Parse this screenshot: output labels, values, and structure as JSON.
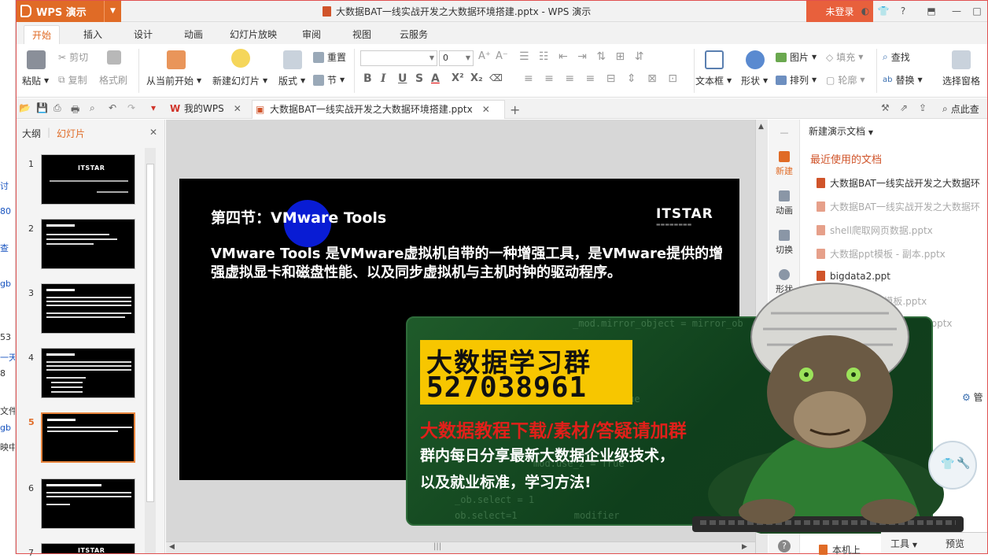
{
  "left_strip": [
    "讨",
    "80",
    "查",
    "gb",
    "53",
    "一天",
    "8",
    "文件",
    "gb",
    "映中"
  ],
  "app": {
    "name": "WPS 演示",
    "doc_title": "大数据BAT一线实战开发之大数据环境搭建.pptx - WPS 演示",
    "login": "未登录"
  },
  "menu_tabs": [
    "开始",
    "插入",
    "设计",
    "动画",
    "幻灯片放映",
    "审阅",
    "视图",
    "云服务"
  ],
  "ribbon": {
    "paste": "粘贴",
    "cut": "剪切",
    "copy": "复制",
    "format_painter": "格式刷",
    "from_current": "从当前开始",
    "new_slide": "新建幻灯片",
    "layout": "版式",
    "reset": "重置",
    "section": "节",
    "font_size": "0",
    "text_box": "文本框",
    "shape": "形状",
    "picture": "图片",
    "fill": "填充",
    "arrange": "排列",
    "outline": "轮廓",
    "find": "查找",
    "replace": "替换",
    "select_pane": "选择窗格"
  },
  "doc_tabs": {
    "home": "我的WPS",
    "file": "大数据BAT一线实战开发之大数据环境搭建.pptx",
    "search": "点此查"
  },
  "left_panel": {
    "tab_outline": "大纲",
    "tab_slides": "幻灯片",
    "slide_numbers": [
      "1",
      "2",
      "3",
      "4",
      "5",
      "6",
      "7"
    ],
    "brand": "ITSTAR"
  },
  "slide": {
    "heading": "第四节：VMware Tools",
    "body": "VMware Tools 是VMware虚拟机自带的一种增强工具，是VMware提供的增强虚拟显卡和磁盘性能、以及同步虚拟机与主机时钟的驱动程序。",
    "logo": "ITSTAR"
  },
  "right_pane": {
    "title": "新建演示文档",
    "recent_title": "最近使用的文档",
    "side_items": [
      "新建",
      "动画",
      "切换",
      "形状"
    ],
    "recent": [
      {
        "name": "大数据BAT一线实战开发之大数据环",
        "dim": false
      },
      {
        "name": "大数据BAT一线实战开发之大数据环",
        "dim": true
      },
      {
        "name": "shell爬取网页数据.pptx",
        "dim": true
      },
      {
        "name": "大数据ppt模板 - 副本.pptx",
        "dim": true
      },
      {
        "name": "bigdata2.ppt",
        "dim": false
      },
      {
        "name": "pt模板.pptx",
        "dim": true
      },
      {
        "name": "].pptx",
        "dim": true
      }
    ],
    "manage": "管",
    "local": "本机上"
  },
  "ad": {
    "title": "大数据学习群",
    "number": "527038961",
    "red_line": "大数据教程下载/素材/答疑请加群",
    "line1": "群内每日分享最新大数据企业级技术，",
    "line2": "以及就业标准，学习方法!"
  },
  "bottom_bar": {
    "tools": "工具",
    "preview": "预览"
  },
  "colors": {
    "accent": "#e06b26",
    "ad_green": "#1f5b2a",
    "ad_yellow": "#f7c600",
    "ad_red": "#e0201a"
  }
}
